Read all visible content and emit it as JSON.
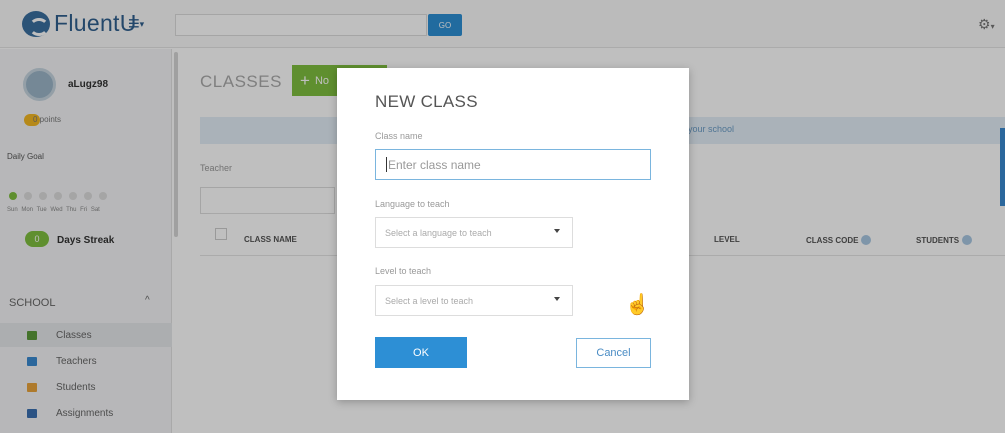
{
  "topbar": {
    "logo_text": "FluentU",
    "menu_icon": "hamburger-icon",
    "go_label": "GO",
    "gear_icon": "gear-icon"
  },
  "sidebar": {
    "username": "aLugz98",
    "points": "0 points",
    "daily_goal": "Daily Goal",
    "week_days": "Sun Mon Tue Wed Thu Fri Sat",
    "streak_count": "0",
    "streak_label": "Days Streak",
    "school_header": "SCHOOL",
    "nav": [
      {
        "label": "Classes",
        "icon": "classes-icon",
        "color": "#5b9a3a"
      },
      {
        "label": "Teachers",
        "icon": "teachers-icon",
        "color": "#3a8ad0"
      },
      {
        "label": "Students",
        "icon": "students-icon",
        "color": "#e8a33b"
      },
      {
        "label": "Assignments",
        "icon": "assignments-icon",
        "color": "#3a6fb0"
      }
    ]
  },
  "main": {
    "title": "CLASSES",
    "new_button": "No",
    "banner_text": "your school",
    "teacher_label": "Teacher",
    "columns": {
      "class_name": "CLASS NAME",
      "level": "LEVEL",
      "class_code": "CLASS CODE",
      "students": "STUDENTS"
    }
  },
  "modal": {
    "title": "NEW CLASS",
    "class_name_label": "Class name",
    "class_name_placeholder": "Enter class name",
    "language_label": "Language to teach",
    "language_value": "Select a language to teach",
    "level_label": "Level to teach",
    "level_value": "Select a level to teach",
    "ok_label": "OK",
    "cancel_label": "Cancel"
  },
  "colors": {
    "brand_blue": "#2d8fd5",
    "brand_green": "#7fbf3f",
    "logo_blue": "#2f5f8e"
  }
}
